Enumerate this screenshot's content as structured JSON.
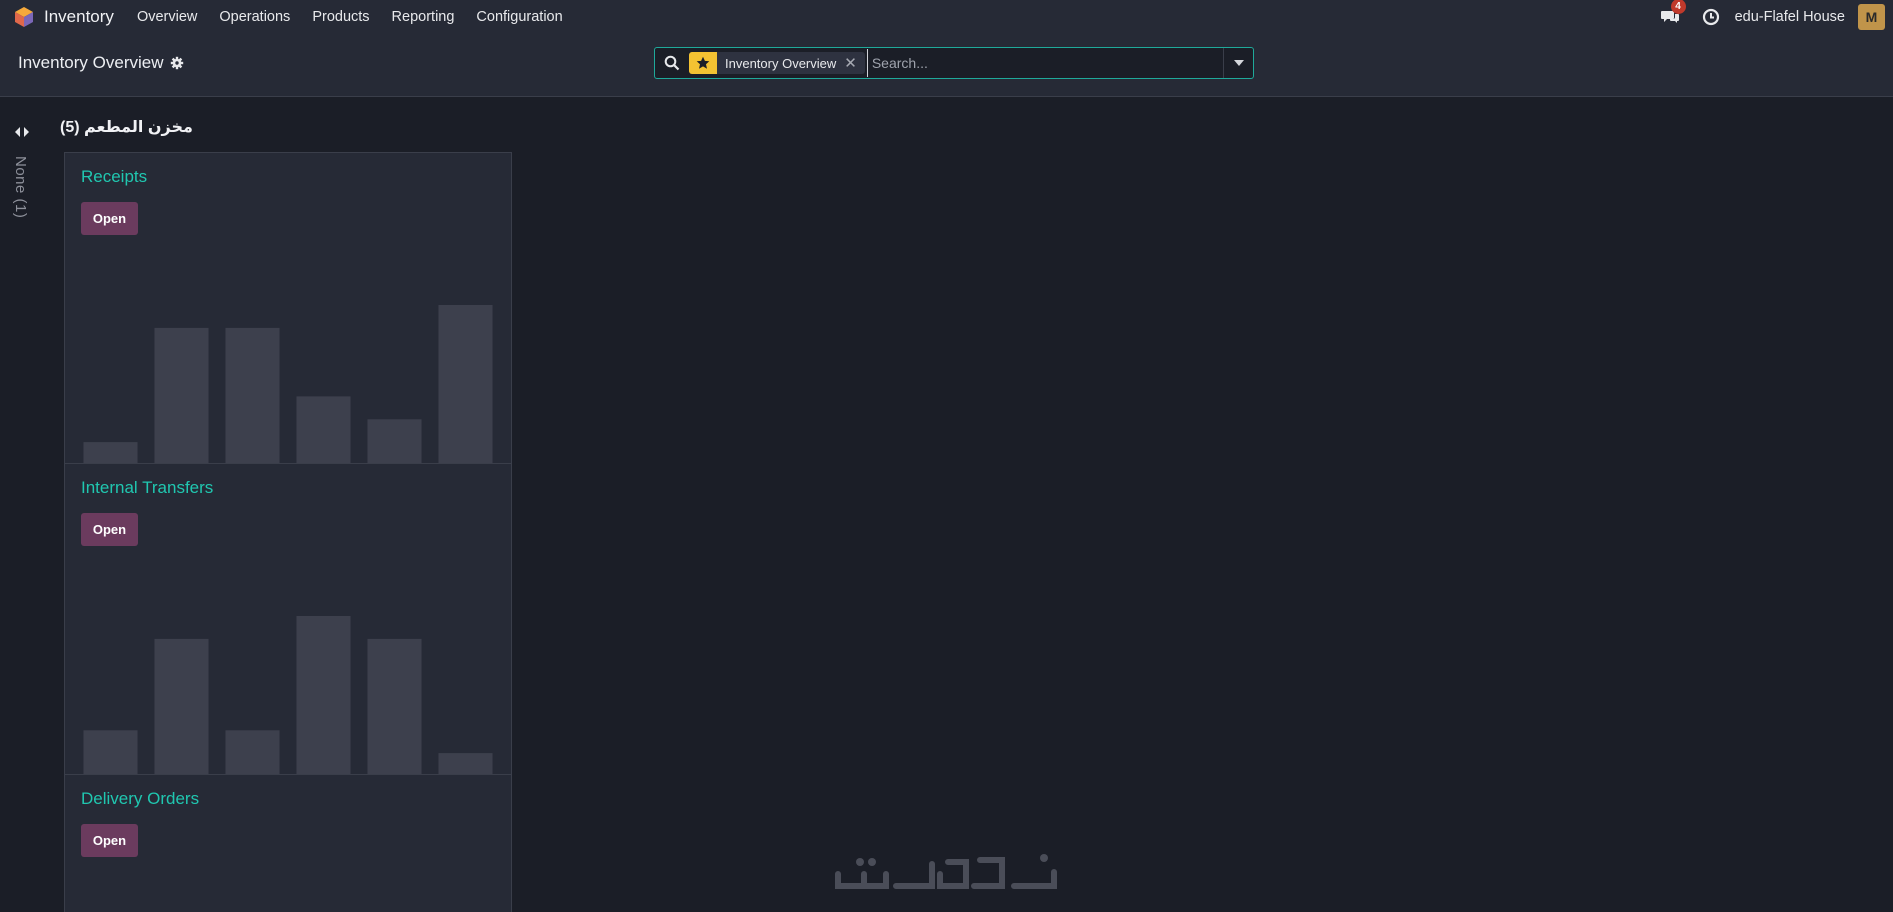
{
  "navbar": {
    "app_name": "Inventory",
    "menu": [
      "Overview",
      "Operations",
      "Products",
      "Reporting",
      "Configuration"
    ],
    "messages_count": "4",
    "company": "edu-Flafel House",
    "avatar_letter": "M"
  },
  "control_panel": {
    "title": "Inventory Overview",
    "search": {
      "facet_label": "Inventory Overview",
      "placeholder": "Search..."
    }
  },
  "kanban": {
    "folded_group": "None (1)",
    "group_title": "مخزن المطعم (5)",
    "cards": [
      {
        "title": "Receipts",
        "button": "Open",
        "chart_values": [
          1,
          6,
          6,
          3,
          2,
          7
        ]
      },
      {
        "title": "Internal Transfers",
        "button": "Open",
        "chart_values": [
          2,
          6,
          2,
          7,
          6,
          1
        ]
      },
      {
        "title": "Delivery Orders",
        "button": "Open",
        "chart_values": []
      }
    ]
  },
  "chart_data": [
    {
      "type": "bar",
      "title": "",
      "categories": [
        "",
        "",
        "",
        "",
        "",
        ""
      ],
      "values": [
        1,
        6,
        6,
        3,
        2,
        7
      ],
      "ylim": [
        0,
        7
      ]
    },
    {
      "type": "bar",
      "title": "",
      "categories": [
        "",
        "",
        "",
        "",
        "",
        ""
      ],
      "values": [
        2,
        6,
        2,
        7,
        6,
        1
      ],
      "ylim": [
        0,
        7
      ]
    }
  ],
  "watermark_text": "خمسات",
  "colors": {
    "accent": "#20c7b0",
    "button": "#6b3b5e",
    "badge": "#c0392b",
    "star": "#f4c232",
    "bar": "#3d404d"
  },
  "icons": [
    "inventory-logo-icon",
    "chat-icon",
    "clock-icon",
    "gear-icon",
    "search-icon",
    "star-icon",
    "remove-facet-icon",
    "caret-down-icon",
    "fold-arrows-icon"
  ]
}
